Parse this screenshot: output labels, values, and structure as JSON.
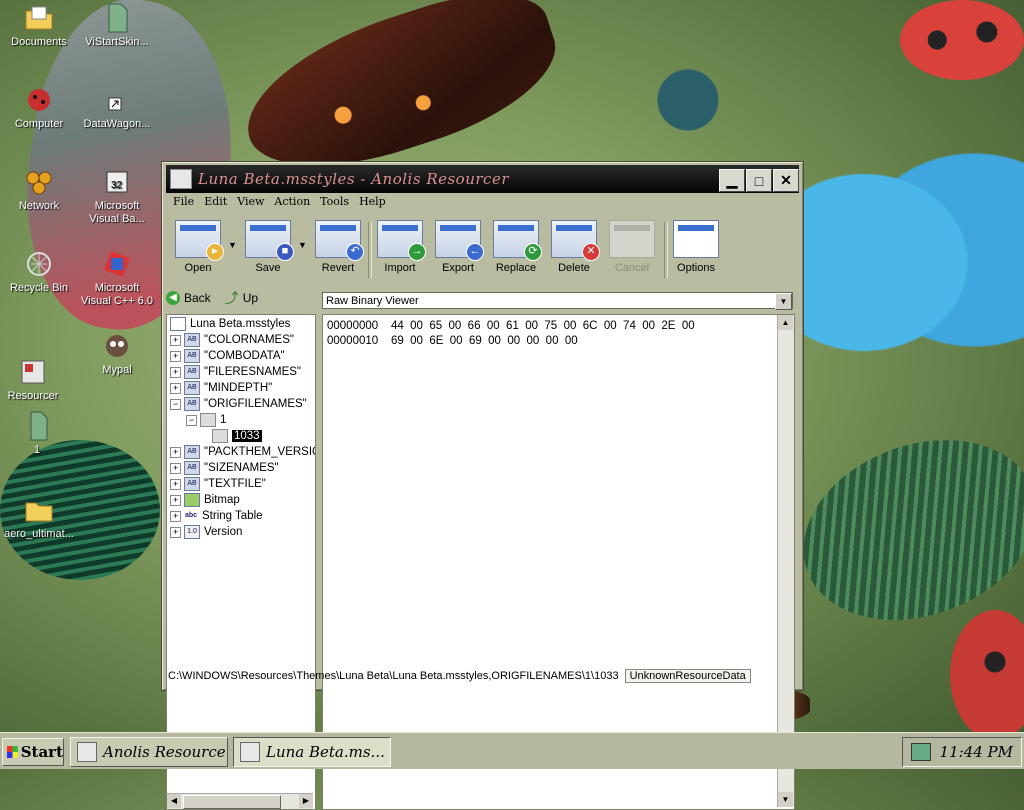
{
  "desktop": {
    "icons": [
      {
        "label": "Documents",
        "icon": "folder-documents-icon"
      },
      {
        "label": "ViStartSkin...",
        "icon": "file-icon"
      },
      {
        "label": "Computer",
        "icon": "computer-icon"
      },
      {
        "label": "DataWagon...",
        "icon": "shortcut-icon"
      },
      {
        "label": "Network",
        "icon": "network-icon"
      },
      {
        "label": "Microsoft Visual Ba...",
        "icon": "visual-basic-icon"
      },
      {
        "label": "Recycle Bin",
        "icon": "recycle-bin-icon"
      },
      {
        "label": "Microsoft Visual C++ 6.0",
        "icon": "visual-cpp-icon"
      },
      {
        "label": "Mypal",
        "icon": "mypal-icon"
      },
      {
        "label": "Resourcer",
        "icon": "resourcer-icon"
      },
      {
        "label": "1",
        "icon": "file-icon"
      },
      {
        "label": "aero_ultimat...",
        "icon": "folder-icon"
      }
    ]
  },
  "window": {
    "title": "Luna Beta.msstyles - Anolis Resourcer",
    "controls": {
      "minimize": "▁",
      "maximize": "□",
      "close": "✕"
    },
    "menu": [
      "File",
      "Edit",
      "View",
      "Action",
      "Tools",
      "Help"
    ],
    "toolbar": {
      "open": "Open",
      "save": "Save",
      "revert": "Revert",
      "import": "Import",
      "export": "Export",
      "replace": "Replace",
      "delete": "Delete",
      "cancel": "Cancel",
      "options": "Options"
    },
    "nav": {
      "back": "Back",
      "up": "Up"
    },
    "viewer": {
      "selected": "Raw Binary Viewer"
    },
    "tree": {
      "root": "Luna Beta.msstyles",
      "items": [
        "\"COLORNAMES\"",
        "\"COMBODATA\"",
        "\"FILERESNAMES\"",
        "\"MINDEPTH\"",
        "\"ORIGFILENAMES\"",
        "1",
        "1033",
        "\"PACKTHEM_VERSIO",
        "\"SIZENAMES\"",
        "\"TEXTFILE\"",
        "Bitmap",
        "String Table",
        "Version"
      ]
    },
    "hex": {
      "rows": [
        {
          "offset": "00000000",
          "bytes": "44  00  65  00  66  00  61  00  75  00  6C  00  74  00  2E  00"
        },
        {
          "offset": "00000010",
          "bytes": "69  00  6E  00  69  00  00  00  00  00"
        }
      ]
    },
    "status": {
      "path": "C:\\WINDOWS\\Resources\\Themes\\Luna Beta\\Luna Beta.msstyles,ORIGFILENAMES\\1\\1033",
      "type": "UnknownResourceData"
    }
  },
  "taskbar": {
    "start": "Start",
    "tasks": [
      "Anolis Resource...",
      "Luna Beta.ms..."
    ],
    "clock": "11:44 PM"
  }
}
